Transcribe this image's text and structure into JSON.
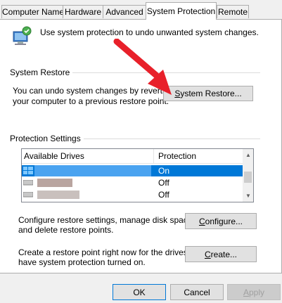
{
  "tabs": [
    {
      "label": "Computer Name",
      "active": false
    },
    {
      "label": "Hardware",
      "active": false
    },
    {
      "label": "Advanced",
      "active": false
    },
    {
      "label": "System Protection",
      "active": true
    },
    {
      "label": "Remote",
      "active": false
    }
  ],
  "intro": {
    "text": "Use system protection to undo unwanted system changes."
  },
  "system_restore": {
    "title": "System Restore",
    "description_line1": "You can undo system changes by reverting",
    "description_line2": "your computer to a previous restore point.",
    "button_label": "System Restore...",
    "button_mnemonic": "S",
    "button_rest": "ystem Restore..."
  },
  "protection_settings": {
    "title": "Protection Settings",
    "columns": [
      "Available Drives",
      "Protection"
    ],
    "rows": [
      {
        "drive": "",
        "protection": "On",
        "selected": true
      },
      {
        "drive": "",
        "protection": "Off",
        "selected": false
      },
      {
        "drive": "",
        "protection": "Off",
        "selected": false
      }
    ]
  },
  "configure": {
    "line1": "Configure restore settings, manage disk space,",
    "line2": "and delete restore points.",
    "button_mnemonic": "C",
    "button_rest": "onfigure..."
  },
  "create": {
    "line1": "Create a restore point right now for the drives that",
    "line2": "have system protection turned on.",
    "button_mnemonic": "C",
    "button_rest": "reate..."
  },
  "footer": {
    "ok": "OK",
    "cancel": "Cancel",
    "apply": "Apply",
    "apply_mnemonic": "A",
    "apply_rest": "pply"
  },
  "colors": {
    "selection": "#0078d7",
    "arrow": "#e8202a",
    "panel": "#ffffff",
    "window": "#f0f0f0"
  }
}
